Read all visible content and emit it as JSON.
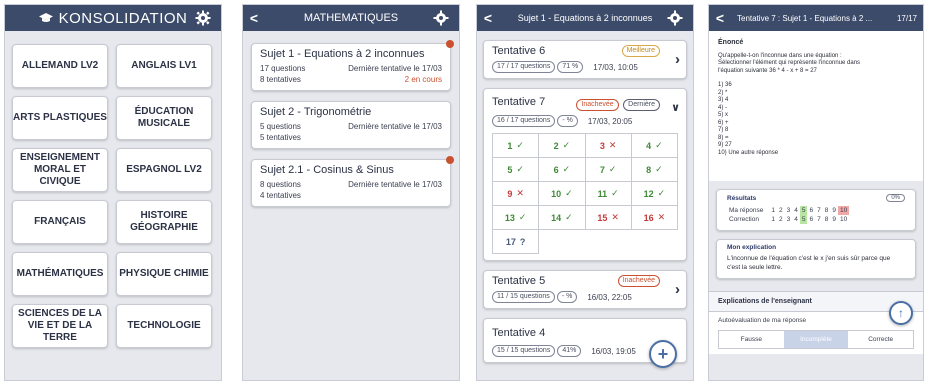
{
  "screen1": {
    "title": "KONSOLIDATION",
    "subjects": [
      "ALLEMAND LV2",
      "ANGLAIS LV1",
      "ARTS PLASTIQUES",
      "ÉDUCATION MUSICALE",
      "ENSEIGNEMENT MORAL ET CIVIQUE",
      "ESPAGNOL LV2",
      "FRANÇAIS",
      "HISTOIRE GÉOGRAPHIE",
      "MATHÉMATIQUES",
      "PHYSIQUE CHIMIE",
      "SCIENCES DE LA VIE ET DE LA TERRE",
      "TECHNOLOGIE"
    ]
  },
  "screen2": {
    "back": "<",
    "title": "MATHEMATIQUES",
    "sujets": [
      {
        "title": "Sujet 1 - Equations à 2 inconnues",
        "questions": "17 questions",
        "last": "Dernière tentative le 17/03",
        "attempts": "8 tentatives",
        "status": "2 en cours"
      },
      {
        "title": "Sujet 2 - Trigonométrie",
        "questions": "5 questions",
        "last": "Dernière tentative le 17/03",
        "attempts": "5 tentatives",
        "status": ""
      },
      {
        "title": "Sujet 2.1 - Cosinus & Sinus",
        "questions": "8 questions",
        "last": "Dernière tentative le 17/03",
        "attempts": "4 tentatives",
        "status": ""
      }
    ]
  },
  "screen3": {
    "back": "<",
    "title": "Sujet 1 - Equations à 2 inconnues",
    "t6": {
      "name": "Tentative 6",
      "tag": "Meilleure",
      "questions": "17 / 17 questions",
      "pct": "71 %",
      "date": "17/03, 10:05"
    },
    "t7": {
      "name": "Tentative 7",
      "tag1": "Inachevée",
      "tag2": "Dernière",
      "questions": "16 / 17 questions",
      "pct": "- %",
      "date": "17/03, 20:05"
    },
    "grid": [
      {
        "n": "1",
        "s": "ok"
      },
      {
        "n": "2",
        "s": "ok"
      },
      {
        "n": "3",
        "s": "ko"
      },
      {
        "n": "4",
        "s": "ok"
      },
      {
        "n": "5",
        "s": "ok"
      },
      {
        "n": "6",
        "s": "ok"
      },
      {
        "n": "7",
        "s": "ok"
      },
      {
        "n": "8",
        "s": "ok"
      },
      {
        "n": "9",
        "s": "ko"
      },
      {
        "n": "10",
        "s": "ok"
      },
      {
        "n": "11",
        "s": "ok"
      },
      {
        "n": "12",
        "s": "ok"
      },
      {
        "n": "13",
        "s": "ok"
      },
      {
        "n": "14",
        "s": "ok"
      },
      {
        "n": "15",
        "s": "ko"
      },
      {
        "n": "16",
        "s": "ko"
      },
      {
        "n": "17",
        "s": "un"
      }
    ],
    "t5": {
      "name": "Tentative 5",
      "tag": "Inachevée",
      "questions": "11 / 15 questions",
      "pct": "- %",
      "date": "16/03, 22:05"
    },
    "t4": {
      "name": "Tentative 4",
      "questions": "15 / 15 questions",
      "pct": "41%",
      "date": "16/03, 19:05"
    }
  },
  "screen4": {
    "back": "<",
    "title": "Tentative 7 : Sujet 1 - Equations à 2 ...",
    "count": "17/17",
    "enonce_label": "Énoncé",
    "enonce_lines": [
      "Qu'appelle-t-on l'inconnue dans une équation :",
      "Sélectionner l'élément qui représente l'inconnue dans",
      "l'équation suivante 36 * 4 - x + 8 = 27",
      "",
      "1) 36",
      "2) *",
      "3) 4",
      "4) -",
      "5) x",
      "6) +",
      "7) 8",
      "8) =",
      "9) 27",
      "10) Une autre réponse"
    ],
    "results_label": "Résultats",
    "results_pct": "0%",
    "ma_reponse_label": "Ma réponse",
    "correction_label": "Correction",
    "ma_reponse": [
      "1",
      "2",
      "3",
      "4",
      "5",
      "6",
      "7",
      "8",
      "9",
      "10"
    ],
    "correction": [
      "1",
      "2",
      "3",
      "4",
      "5",
      "6",
      "7",
      "8",
      "9",
      "10"
    ],
    "explication_label": "Mon explication",
    "explication_text": "L'inconnue de l'équation c'est le x j'en suis sûr parce que c'est la seule lettre.",
    "teacher_label": "Explications de l'enseignant",
    "autoeval_label": "Autoévaluation de ma réponse",
    "seg": [
      "Fausse",
      "Incomplète",
      "Correcte"
    ],
    "seg_selected": "Incomplète"
  },
  "colors": {
    "header": "#3d4b6a",
    "accent_red": "#c9512f",
    "ok_green": "#3f8a35",
    "ko_red": "#c53a3a"
  }
}
